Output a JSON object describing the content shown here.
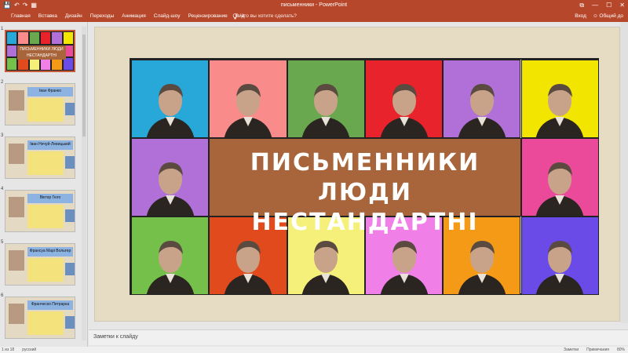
{
  "titlebar": {
    "title": "письменники - PowerPoint",
    "quick_access": [
      "💾",
      "↶",
      "↷",
      "▦"
    ],
    "window_controls": [
      "⧉",
      "—",
      "☐",
      "✕"
    ]
  },
  "ribbon": {
    "file_label": "",
    "tabs": [
      "Главная",
      "Вставка",
      "Дизайн",
      "Переходы",
      "Анимация",
      "Слайд-шоу",
      "Рецензирование",
      "Вид"
    ],
    "search_icon": "lightbulb-icon",
    "search_placeholder": "Что вы хотите сделать?",
    "signin_label": "Вход",
    "share_label": "Общий до"
  },
  "slides": [
    {
      "num": "1",
      "kind": "title",
      "banner": "ПИСЬМЕННИКИ ЛЮДИ НЕСТАНДАРТНІ"
    },
    {
      "num": "2",
      "heading": "Іван Франко"
    },
    {
      "num": "3",
      "heading": "Іван Нечуй-Левицький"
    },
    {
      "num": "4",
      "heading": "Віктор Гюго"
    },
    {
      "num": "5",
      "heading": "Франсуа Марі Вольтер"
    },
    {
      "num": "6",
      "heading": "Франческо Петрарка"
    }
  ],
  "main_slide": {
    "banner_line1": "ПИСЬМЕННИКИ ЛЮДИ",
    "banner_line2": "НЕСТАНДАРТНІ",
    "cell_colors": [
      [
        "#27a8d8",
        "#f98b8b",
        "#6aa84f",
        "#e8232b",
        "#b070d8",
        "#f2e600"
      ],
      [
        "#b070d8",
        "#eb4a9a"
      ],
      [
        "#75c04a",
        "#e04a1c",
        "#f5f07a",
        "#f080e8",
        "#f59a16",
        "#6a4be8"
      ]
    ]
  },
  "notes": {
    "placeholder": "Заметки к слайду"
  },
  "status": {
    "slide_info": "1 из 18",
    "language": "русский",
    "notes_label": "Заметки",
    "comments_label": "Примечания",
    "zoom": "80%"
  }
}
